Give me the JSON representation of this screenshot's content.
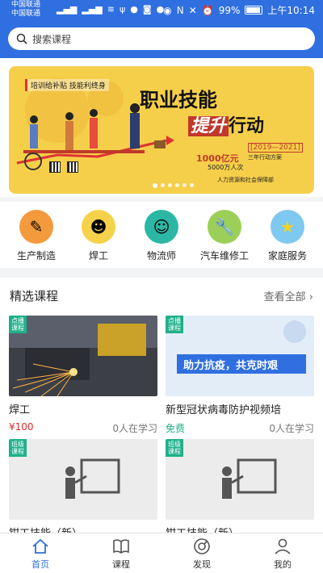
{
  "status_bar": {
    "carrier1": "中国联通",
    "carrier2": "中国联通",
    "battery": "99%",
    "time": "上午10:14"
  },
  "search": {
    "placeholder": "搜索课程"
  },
  "banner": {
    "tag": "培训给补贴 技能利终身",
    "title_line1": "职业技能",
    "title_line2_highlight": "提升",
    "title_line2_rest": "行动",
    "year_range": "[2019—2021]",
    "plan": "三年行动方案",
    "money": "1000亿元",
    "people": "5000万人次",
    "ministry": "人力资源和社会保障部",
    "slide_count": 6,
    "active_slide": 0
  },
  "categories": [
    {
      "label": "生产制造",
      "icon": "pencil-ruler-icon",
      "color": "#f39a3c"
    },
    {
      "label": "焊工",
      "icon": "welder-icon",
      "color": "#f6d24a"
    },
    {
      "label": "物流师",
      "icon": "logistics-person-icon",
      "color": "#2bb7a4"
    },
    {
      "label": "汽车维修工",
      "icon": "wrench-icon",
      "color": "#9ccf57"
    },
    {
      "label": "家庭服务",
      "icon": "star-icon",
      "color": "#7fc9f0"
    }
  ],
  "featured": {
    "title": "精选课程",
    "more": "查看全部",
    "courses": [
      {
        "badge": "点播课程",
        "title": "焊工",
        "price": "¥100",
        "price_type": "paid",
        "learners": "0人在学习",
        "image": "welding-sparks-photo"
      },
      {
        "badge": "点播课程",
        "title": "新型冠状病毒防护视频培",
        "price": "免费",
        "price_type": "free",
        "learners": "0人在学习",
        "image": "virus-prevention-poster",
        "poster_text": "助力抗疫，共克时艰"
      },
      {
        "badge": "班级课程",
        "title": "钳工技能（新）",
        "image": "teacher-board-placeholder"
      },
      {
        "badge": "班级课程",
        "title": "钳工技能（新）",
        "image": "teacher-board-placeholder"
      }
    ]
  },
  "tabbar": {
    "active": 0,
    "items": [
      {
        "label": "首页",
        "icon": "home-icon"
      },
      {
        "label": "课程",
        "icon": "book-icon"
      },
      {
        "label": "发现",
        "icon": "discover-icon"
      },
      {
        "label": "我的",
        "icon": "user-icon"
      }
    ]
  },
  "colors": {
    "primary": "#2f6fe0",
    "accent_green": "#1fb08a",
    "price_red": "#e02b2b",
    "banner_yellow": "#f6cf4a"
  }
}
